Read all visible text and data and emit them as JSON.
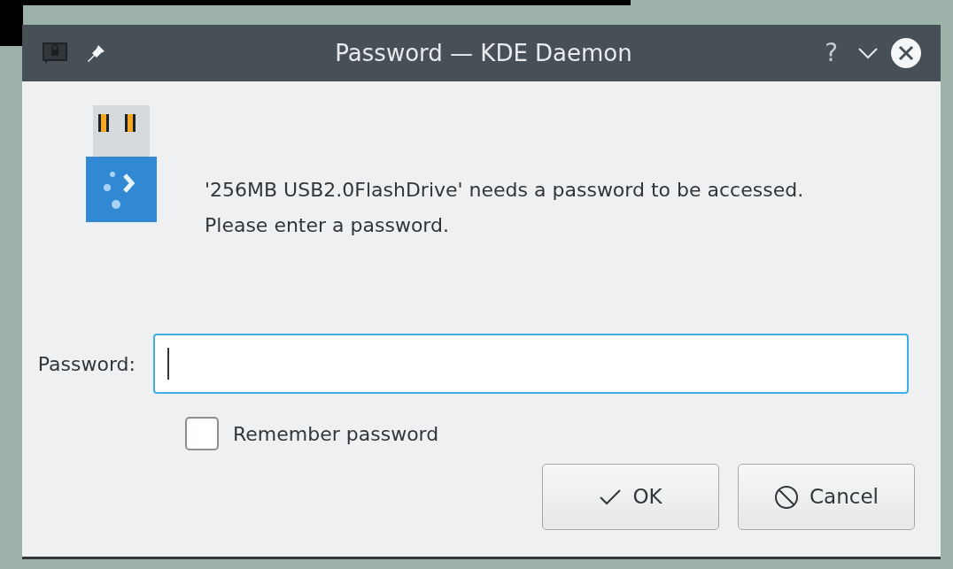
{
  "window": {
    "title": "Password — KDE Daemon",
    "help": "?"
  },
  "message": {
    "line_1": "'256MB USB2.0FlashDrive' needs a password to be accessed.",
    "line_2": "Please enter a password."
  },
  "password_field": {
    "label": "Password:",
    "focused": true
  },
  "remember": {
    "label": "Remember password",
    "checked": false
  },
  "buttons": [
    {
      "kind": "ok",
      "label": "OK"
    },
    {
      "kind": "cancel",
      "label": "Cancel"
    }
  ]
}
